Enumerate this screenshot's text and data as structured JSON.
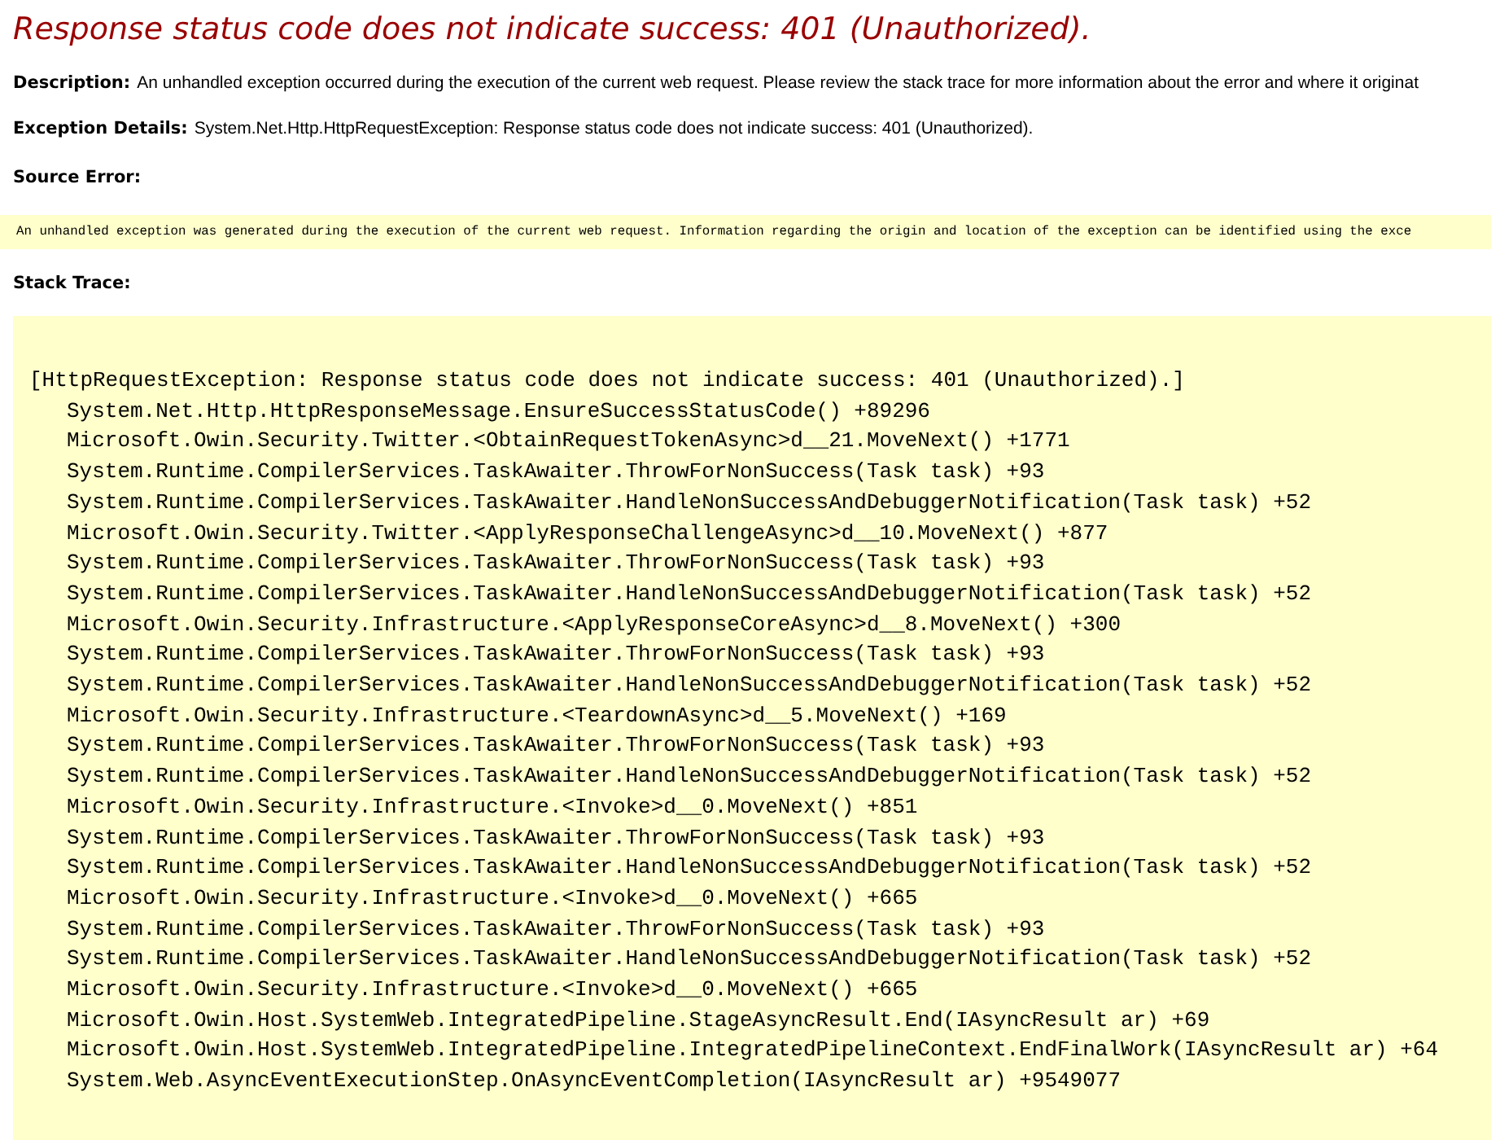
{
  "title": "Response status code does not indicate success: 401 (Unauthorized).",
  "description": {
    "label": "Description:",
    "text": "An unhandled exception occurred during the execution of the current web request. Please review the stack trace for more information about the error and where it originat"
  },
  "exception_details": {
    "label": "Exception Details:",
    "text": "System.Net.Http.HttpRequestException: Response status code does not indicate success: 401 (Unauthorized)."
  },
  "source_error": {
    "label": "Source Error:",
    "text": "An unhandled exception was generated during the execution of the current web request. Information regarding the origin and location of the exception can be identified using the exce"
  },
  "stack_trace": {
    "label": "Stack Trace:",
    "exception": "[HttpRequestException: Response status code does not indicate success: 401 (Unauthorized).]",
    "frames": [
      "System.Net.Http.HttpResponseMessage.EnsureSuccessStatusCode() +89296",
      "Microsoft.Owin.Security.Twitter.<ObtainRequestTokenAsync>d__21.MoveNext() +1771",
      "System.Runtime.CompilerServices.TaskAwaiter.ThrowForNonSuccess(Task task) +93",
      "System.Runtime.CompilerServices.TaskAwaiter.HandleNonSuccessAndDebuggerNotification(Task task) +52",
      "Microsoft.Owin.Security.Twitter.<ApplyResponseChallengeAsync>d__10.MoveNext() +877",
      "System.Runtime.CompilerServices.TaskAwaiter.ThrowForNonSuccess(Task task) +93",
      "System.Runtime.CompilerServices.TaskAwaiter.HandleNonSuccessAndDebuggerNotification(Task task) +52",
      "Microsoft.Owin.Security.Infrastructure.<ApplyResponseCoreAsync>d__8.MoveNext() +300",
      "System.Runtime.CompilerServices.TaskAwaiter.ThrowForNonSuccess(Task task) +93",
      "System.Runtime.CompilerServices.TaskAwaiter.HandleNonSuccessAndDebuggerNotification(Task task) +52",
      "Microsoft.Owin.Security.Infrastructure.<TeardownAsync>d__5.MoveNext() +169",
      "System.Runtime.CompilerServices.TaskAwaiter.ThrowForNonSuccess(Task task) +93",
      "System.Runtime.CompilerServices.TaskAwaiter.HandleNonSuccessAndDebuggerNotification(Task task) +52",
      "Microsoft.Owin.Security.Infrastructure.<Invoke>d__0.MoveNext() +851",
      "System.Runtime.CompilerServices.TaskAwaiter.ThrowForNonSuccess(Task task) +93",
      "System.Runtime.CompilerServices.TaskAwaiter.HandleNonSuccessAndDebuggerNotification(Task task) +52",
      "Microsoft.Owin.Security.Infrastructure.<Invoke>d__0.MoveNext() +665",
      "System.Runtime.CompilerServices.TaskAwaiter.ThrowForNonSuccess(Task task) +93",
      "System.Runtime.CompilerServices.TaskAwaiter.HandleNonSuccessAndDebuggerNotification(Task task) +52",
      "Microsoft.Owin.Security.Infrastructure.<Invoke>d__0.MoveNext() +665",
      "Microsoft.Owin.Host.SystemWeb.IntegratedPipeline.StageAsyncResult.End(IAsyncResult ar) +69",
      "Microsoft.Owin.Host.SystemWeb.IntegratedPipeline.IntegratedPipelineContext.EndFinalWork(IAsyncResult ar) +64",
      "System.Web.AsyncEventExecutionStep.OnAsyncEventCompletion(IAsyncResult ar) +9549077"
    ]
  }
}
